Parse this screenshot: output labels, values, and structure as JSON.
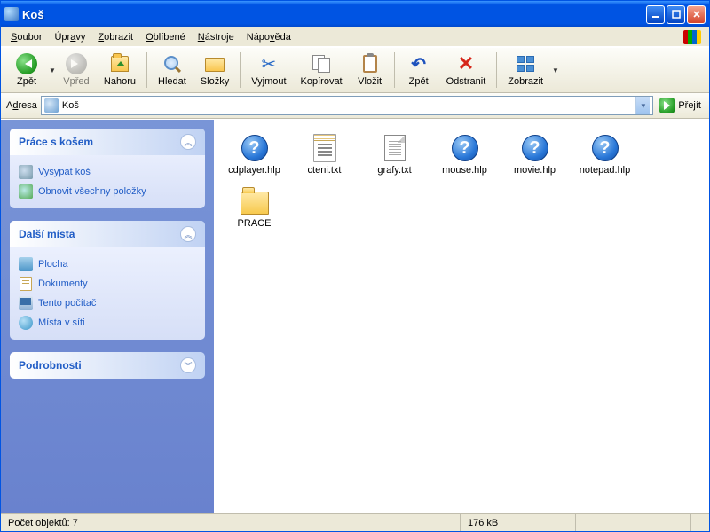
{
  "titlebar": {
    "title": "Koš"
  },
  "menubar": {
    "items": [
      {
        "pre": "",
        "key": "S",
        "post": "oubor"
      },
      {
        "pre": "Úpr",
        "key": "a",
        "post": "vy"
      },
      {
        "pre": "",
        "key": "Z",
        "post": "obrazit"
      },
      {
        "pre": "",
        "key": "O",
        "post": "blíbené"
      },
      {
        "pre": "",
        "key": "N",
        "post": "ástroje"
      },
      {
        "pre": "Nápo",
        "key": "v",
        "post": "ěda"
      }
    ]
  },
  "toolbar": {
    "back": "Zpět",
    "forward": "Vpřed",
    "up": "Nahoru",
    "search": "Hledat",
    "folders": "Složky",
    "cut": "Vyjmout",
    "copy": "Kopírovat",
    "paste": "Vložit",
    "undo": "Zpět",
    "delete": "Odstranit",
    "views": "Zobrazit"
  },
  "addressbar": {
    "label_pre": "A",
    "label_key": "d",
    "label_post": "resa",
    "value": "Koš",
    "go": "Přejít"
  },
  "sidebar": {
    "panel1": {
      "title": "Práce s košem",
      "empty": "Vysypat koš",
      "restore": "Obnovit všechny položky"
    },
    "panel2": {
      "title": "Další místa",
      "desktop": "Plocha",
      "documents": "Dokumenty",
      "computer": "Tento počítač",
      "network": "Místa v síti"
    },
    "panel3": {
      "title": "Podrobnosti"
    }
  },
  "files": [
    {
      "name": "cdplayer.hlp",
      "type": "help"
    },
    {
      "name": "cteni.txt",
      "type": "text1"
    },
    {
      "name": "grafy.txt",
      "type": "text2"
    },
    {
      "name": "mouse.hlp",
      "type": "help"
    },
    {
      "name": "movie.hlp",
      "type": "help"
    },
    {
      "name": "notepad.hlp",
      "type": "help"
    },
    {
      "name": "PRACE",
      "type": "folder"
    }
  ],
  "statusbar": {
    "objects": "Počet objektů: 7",
    "size": "176 kB"
  }
}
